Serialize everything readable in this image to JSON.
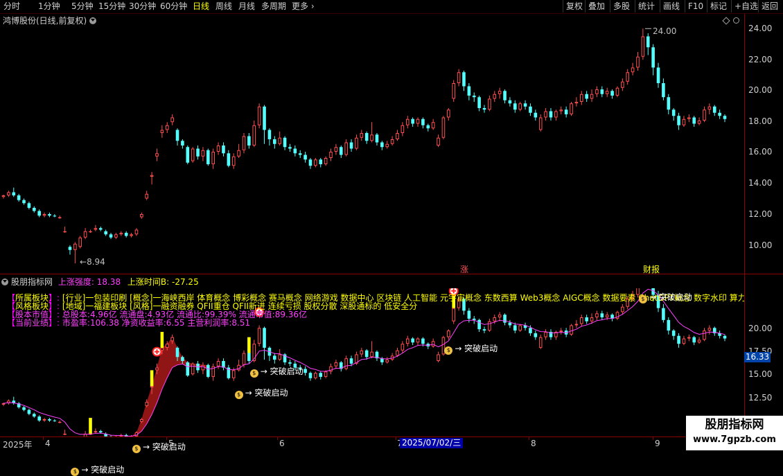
{
  "toolbar": {
    "periods": [
      "分时",
      "1分钟",
      "5分钟",
      "15分钟",
      "30分钟",
      "60分钟",
      "日线",
      "周线",
      "月线",
      "多周期",
      "更多"
    ],
    "selected": "日线",
    "more_arrow": "›",
    "right_buttons": [
      "复权",
      "叠加",
      "多股",
      "统计",
      "画线",
      "F10",
      "标记",
      "+自选",
      "返回"
    ]
  },
  "main_chart": {
    "title": "鸿博股份(日线,前复权)",
    "y_ticks": [
      "24.00",
      "22.00",
      "20.00",
      "18.00",
      "16.00",
      "14.00",
      "12.00",
      "10.00"
    ],
    "high_label": "24.00",
    "low_label": "8.94",
    "event_zhang": "涨",
    "event_caibao": "财报"
  },
  "indicator": {
    "name": "股朋指标网",
    "strength_label": "上涨强度:",
    "strength_value": "18.38",
    "time_label": "上涨时间B:",
    "time_value": "-27.25",
    "rows": [
      {
        "key": "所属板块",
        "text": "[行业]一包装印刷 [概念]一海峡西岸 体育概念 博彩概念 赛马概念 网络游戏 数据中心 区块链 人工智能 元宇宙概念 东数西算 Web3概念 AIGC概念 数据要素 ChatGPT概念 数字水印 算力租赁"
      },
      {
        "key": "风格板块",
        "text": "[地域]一福建板块 [风格]一融资融券 QFII重仓 QFII新进 连续亏损 股权分散 深股通标的 低安全分"
      },
      {
        "key": "股本市值",
        "text": "总股本:4.96亿 流通盘:4.93亿 流通比:99.39% 流通市值:89.36亿"
      },
      {
        "key": "当前业绩",
        "text": "市盈率:106.38 净资收益率:6.55 主营利润率:8.51"
      }
    ],
    "y_ticks": [
      "20.00",
      "17.50",
      "15.00",
      "12.50"
    ],
    "current_price": "16.33",
    "signal_text": "突破启动"
  },
  "date_axis": {
    "year": "2025年",
    "months": [
      "4",
      "5",
      "6",
      "7",
      "8",
      "9"
    ],
    "cursor_date": "2025/07/02/三"
  },
  "watermark": {
    "line1": "股朋指标网",
    "line2": "www.7gpzb.com"
  },
  "colors": {
    "up": "#ff5050",
    "down": "#54ffff",
    "axis": "#8b0000",
    "accent": "#ffff00",
    "label_magenta": "#ff00ff"
  },
  "chart_data": {
    "type": "candlestick",
    "ylim_main": [
      8.5,
      24.5
    ],
    "ylim_indicator": [
      11.0,
      22.0
    ],
    "candles": [
      [
        13.2,
        13.3,
        13.1,
        13.35
      ],
      [
        13.3,
        13.5,
        13.2,
        13.6
      ],
      [
        13.5,
        13.3,
        13.2,
        13.8
      ],
      [
        13.3,
        13.0,
        12.9,
        13.4
      ],
      [
        13.0,
        12.8,
        12.7,
        13.1
      ],
      [
        12.8,
        12.5,
        12.4,
        12.9
      ],
      [
        12.5,
        12.3,
        12.2,
        12.6
      ],
      [
        12.3,
        12.0,
        11.9,
        12.4
      ],
      [
        12.0,
        12.1,
        11.9,
        12.2
      ],
      [
        12.1,
        12.0,
        11.9,
        12.2
      ],
      [
        12.0,
        11.95,
        11.9,
        12.1
      ],
      [
        11.9,
        11.9,
        11.8,
        12.0
      ],
      [
        11.0,
        11.0,
        10.9,
        11.3
      ],
      [
        10.0,
        9.8,
        9.5,
        10.1
      ],
      [
        9.8,
        10.2,
        8.94,
        10.3
      ],
      [
        10.0,
        10.6,
        9.9,
        10.7
      ],
      [
        10.6,
        11.0,
        10.5,
        11.2
      ],
      [
        11.0,
        11.0,
        10.9,
        11.1
      ],
      [
        11.1,
        11.2,
        11.0,
        11.4
      ],
      [
        11.2,
        11.1,
        11.0,
        11.3
      ],
      [
        11.0,
        10.8,
        10.7,
        11.1
      ],
      [
        10.8,
        10.6,
        10.5,
        10.9
      ],
      [
        10.6,
        10.8,
        10.5,
        10.9
      ],
      [
        10.8,
        10.9,
        10.7,
        11.0
      ],
      [
        10.9,
        10.7,
        10.6,
        11.0
      ],
      [
        10.7,
        10.8,
        10.6,
        10.9
      ],
      [
        10.8,
        11.1,
        10.7,
        11.2
      ],
      [
        11.9,
        12.1,
        11.8,
        12.2
      ],
      [
        13.1,
        13.4,
        13.0,
        13.6
      ],
      [
        14.5,
        14.6,
        14.0,
        14.8
      ],
      [
        15.8,
        16.0,
        15.5,
        16.3
      ],
      [
        17.3,
        17.5,
        17.0,
        17.8
      ],
      [
        17.5,
        17.8,
        17.3,
        18.0
      ],
      [
        18.0,
        18.3,
        17.8,
        18.5
      ],
      [
        17.5,
        16.8,
        16.5,
        17.6
      ],
      [
        16.8,
        16.5,
        16.3,
        16.9
      ],
      [
        16.4,
        15.4,
        15.3,
        16.5
      ],
      [
        15.5,
        16.3,
        15.4,
        16.4
      ],
      [
        16.3,
        15.8,
        15.6,
        16.5
      ],
      [
        15.8,
        16.2,
        15.5,
        16.4
      ],
      [
        16.2,
        15.3,
        15.2,
        16.3
      ],
      [
        15.3,
        16.1,
        15.0,
        16.3
      ],
      [
        16.1,
        16.5,
        15.9,
        16.7
      ],
      [
        16.5,
        16.0,
        15.8,
        16.7
      ],
      [
        16.0,
        15.2,
        15.1,
        16.2
      ],
      [
        15.2,
        15.8,
        15.0,
        16.0
      ],
      [
        15.8,
        16.2,
        15.7,
        16.6
      ],
      [
        16.2,
        17.1,
        16.0,
        17.3
      ],
      [
        17.1,
        16.5,
        16.3,
        17.3
      ],
      [
        16.5,
        17.8,
        16.4,
        18.1
      ],
      [
        17.8,
        19.0,
        17.6,
        19.2
      ],
      [
        19.0,
        17.5,
        16.6,
        19.1
      ],
      [
        17.5,
        16.9,
        16.5,
        17.6
      ],
      [
        16.9,
        16.6,
        16.3,
        17.1
      ],
      [
        16.6,
        17.0,
        16.5,
        17.4
      ],
      [
        17.0,
        16.4,
        16.2,
        17.1
      ],
      [
        16.4,
        16.3,
        16.1,
        16.6
      ],
      [
        16.3,
        16.0,
        15.8,
        16.5
      ],
      [
        16.0,
        15.9,
        15.7,
        16.2
      ],
      [
        15.9,
        15.6,
        15.4,
        16.1
      ],
      [
        15.6,
        15.2,
        15.0,
        15.7
      ],
      [
        15.2,
        15.6,
        15.1,
        15.7
      ],
      [
        15.6,
        15.3,
        15.1,
        15.7
      ],
      [
        15.3,
        15.7,
        15.2,
        15.8
      ],
      [
        15.7,
        16.1,
        15.5,
        16.3
      ],
      [
        16.1,
        16.4,
        15.9,
        16.6
      ],
      [
        16.4,
        15.9,
        15.7,
        16.5
      ],
      [
        15.9,
        16.7,
        15.8,
        16.9
      ],
      [
        16.7,
        16.3,
        16.1,
        16.9
      ],
      [
        16.3,
        17.0,
        16.2,
        17.2
      ],
      [
        17.0,
        17.3,
        16.8,
        17.5
      ],
      [
        17.3,
        16.8,
        16.6,
        17.4
      ],
      [
        16.8,
        17.2,
        16.7,
        18.0
      ],
      [
        17.2,
        16.7,
        16.5,
        17.3
      ],
      [
        16.7,
        16.4,
        16.2,
        16.8
      ],
      [
        16.4,
        16.6,
        16.3,
        16.8
      ],
      [
        16.6,
        16.9,
        16.5,
        17.1
      ],
      [
        16.9,
        17.3,
        16.8,
        17.5
      ],
      [
        17.3,
        17.8,
        17.1,
        18.0
      ],
      [
        17.8,
        18.2,
        17.6,
        18.4
      ],
      [
        18.2,
        17.9,
        17.7,
        18.3
      ],
      [
        17.9,
        18.2,
        17.7,
        18.3
      ],
      [
        18.2,
        17.8,
        17.6,
        18.3
      ],
      [
        17.8,
        17.6,
        17.4,
        17.9
      ],
      [
        17.6,
        18.0,
        17.5,
        18.2
      ],
      [
        16.5,
        17.0,
        16.4,
        17.2
      ],
      [
        17.0,
        18.3,
        16.9,
        18.4
      ],
      [
        18.3,
        18.8,
        18.1,
        18.9
      ],
      [
        19.5,
        20.5,
        19.3,
        20.7
      ],
      [
        20.5,
        21.2,
        20.3,
        21.4
      ],
      [
        21.2,
        20.3,
        20.0,
        21.3
      ],
      [
        20.3,
        19.7,
        19.4,
        20.5
      ],
      [
        19.7,
        19.6,
        19.3,
        19.9
      ],
      [
        19.6,
        18.9,
        18.7,
        19.7
      ],
      [
        18.9,
        18.8,
        18.6,
        19.1
      ],
      [
        18.8,
        19.5,
        18.7,
        19.7
      ],
      [
        19.5,
        19.8,
        19.3,
        20.0
      ],
      [
        19.8,
        20.0,
        19.5,
        20.2
      ],
      [
        20.0,
        19.4,
        19.2,
        20.1
      ],
      [
        19.4,
        19.2,
        19.0,
        19.6
      ],
      [
        19.2,
        18.8,
        18.6,
        19.4
      ],
      [
        18.8,
        19.2,
        18.7,
        19.3
      ],
      [
        19.2,
        19.0,
        18.8,
        19.4
      ],
      [
        19.0,
        18.6,
        18.4,
        19.2
      ],
      [
        18.6,
        18.3,
        18.1,
        18.8
      ],
      [
        17.5,
        18.3,
        17.4,
        18.5
      ],
      [
        18.3,
        18.7,
        18.1,
        18.9
      ],
      [
        18.7,
        18.3,
        18.1,
        18.9
      ],
      [
        18.3,
        18.7,
        18.1,
        18.8
      ],
      [
        18.7,
        18.8,
        18.5,
        19.0
      ],
      [
        18.8,
        18.5,
        18.3,
        19.0
      ],
      [
        18.5,
        19.2,
        18.4,
        19.3
      ],
      [
        19.2,
        19.3,
        19.0,
        19.6
      ],
      [
        19.3,
        19.8,
        19.1,
        20.0
      ],
      [
        19.8,
        19.5,
        19.3,
        20.0
      ],
      [
        19.5,
        19.8,
        19.3,
        20.1
      ],
      [
        19.8,
        20.1,
        19.6,
        20.3
      ],
      [
        20.1,
        19.8,
        19.6,
        20.3
      ],
      [
        19.8,
        20.0,
        19.6,
        20.2
      ],
      [
        20.0,
        19.7,
        19.5,
        20.1
      ],
      [
        19.7,
        20.2,
        19.6,
        20.3
      ],
      [
        20.2,
        20.6,
        20.0,
        20.8
      ],
      [
        20.6,
        21.2,
        20.4,
        21.4
      ],
      [
        21.2,
        21.5,
        21.0,
        21.8
      ],
      [
        21.5,
        22.2,
        21.3,
        22.5
      ],
      [
        22.2,
        23.5,
        22.0,
        24.0
      ],
      [
        23.5,
        22.8,
        22.3,
        23.7
      ],
      [
        22.8,
        21.5,
        21.0,
        23.0
      ],
      [
        21.5,
        20.5,
        20.2,
        21.8
      ],
      [
        20.5,
        19.6,
        19.4,
        20.8
      ],
      [
        19.6,
        18.8,
        18.5,
        19.8
      ],
      [
        18.8,
        18.4,
        18.1,
        18.9
      ],
      [
        18.4,
        17.8,
        17.5,
        18.6
      ],
      [
        17.8,
        18.2,
        17.7,
        18.4
      ],
      [
        18.2,
        18.3,
        18.0,
        18.5
      ],
      [
        18.3,
        17.9,
        17.7,
        18.4
      ],
      [
        17.9,
        18.1,
        17.8,
        18.3
      ],
      [
        18.1,
        18.8,
        18.0,
        19.0
      ],
      [
        18.8,
        19.0,
        18.5,
        19.2
      ],
      [
        19.0,
        18.6,
        18.4,
        19.1
      ],
      [
        18.6,
        18.4,
        18.2,
        18.8
      ],
      [
        18.4,
        18.2,
        18.0,
        18.5
      ]
    ]
  }
}
